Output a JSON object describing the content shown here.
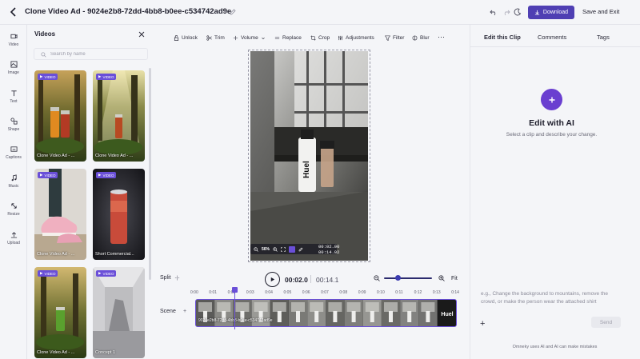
{
  "header": {
    "title": "Clone Video Ad - 9024e2b8-72dd-4bb8-b0ee-c534742ad9e",
    "download_label": "Download",
    "save_exit_label": "Save and Exit"
  },
  "rail": {
    "items": [
      {
        "label": "Video",
        "icon": "video-icon"
      },
      {
        "label": "Image",
        "icon": "image-icon"
      },
      {
        "label": "Text",
        "icon": "text-icon"
      },
      {
        "label": "Shape",
        "icon": "shape-icon"
      },
      {
        "label": "Captions",
        "icon": "captions-icon"
      },
      {
        "label": "Music",
        "icon": "music-icon"
      },
      {
        "label": "Resize",
        "icon": "resize-icon"
      },
      {
        "label": "Upload",
        "icon": "upload-icon"
      }
    ]
  },
  "videos_panel": {
    "title": "Videos",
    "search_placeholder": "Search by name",
    "badge": "VIDEO",
    "items": [
      {
        "label": "Clone Video Ad - ..."
      },
      {
        "label": "Clone Video Ad - ..."
      },
      {
        "label": "Clone Video Ad - ..."
      },
      {
        "label": "Short Commercial..."
      },
      {
        "label": "Clone Video Ad - ..."
      },
      {
        "label": "Concept 1"
      }
    ]
  },
  "toolbar": {
    "items": [
      "Unlock",
      "Trim",
      "Volume",
      "Replace",
      "Crop",
      "Adjustments",
      "Filter",
      "Blur"
    ]
  },
  "canvas": {
    "zoom": "56%",
    "time_current": "00:02.00",
    "time_total": "00:14.02",
    "product_text": "Huel"
  },
  "playback": {
    "split_label": "Split",
    "current_time": "00:02.0",
    "total_time": "00:14.1",
    "fit_label": "Fit",
    "zoom_level": 0.28
  },
  "timeline": {
    "ticks": [
      "0:00",
      "0:01",
      "0:02",
      "0:03",
      "0:04",
      "0:05",
      "0:06",
      "0:07",
      "0:08",
      "0:09",
      "0:10",
      "0:11",
      "0:12",
      "0:13",
      "0:14"
    ],
    "scene_label": "Scene",
    "clip_label": "9024e2b8-72dd-4bb8-b0ee-c534742ad9e",
    "playhead_time": 2.0
  },
  "right_panel": {
    "tabs": [
      "Edit this Clip",
      "Comments",
      "Tags"
    ],
    "ai_title": "Edit with AI",
    "ai_subtitle": "Select a clip and describe your change.",
    "prompt_placeholder": "e.g., Change the background to mountains, remove the crowd, or make the person wear the attached shirt",
    "send_label": "Send",
    "disclaimer": "Omneky uses AI and AI can make mistakes"
  },
  "colors": {
    "accent": "#4f3fb3",
    "badge": "#6a4fd8",
    "ai_button": "#6a3fd0"
  }
}
